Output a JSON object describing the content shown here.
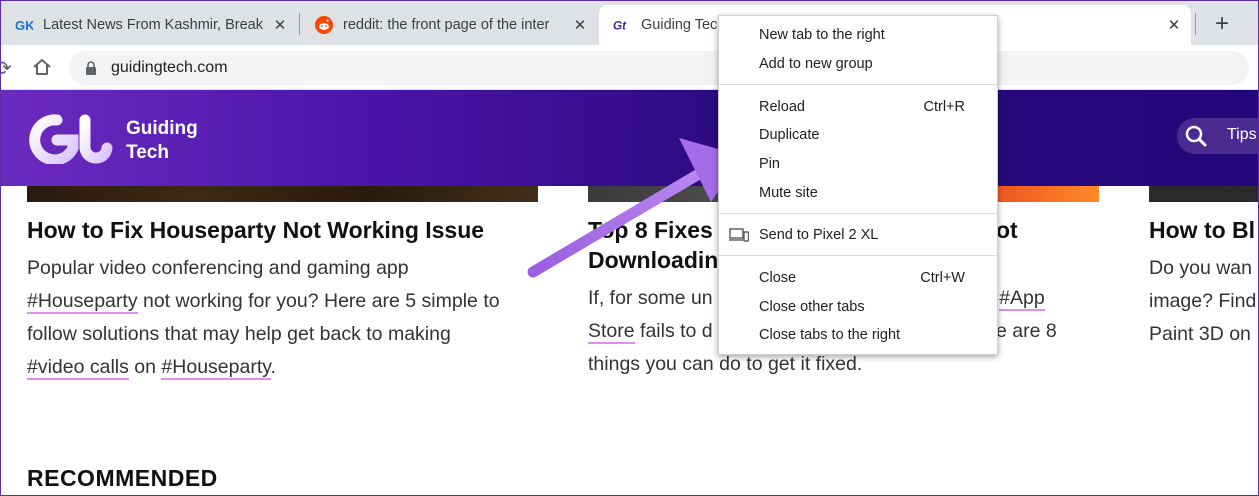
{
  "tabs": [
    {
      "favicon": "gk-icon",
      "title": "Latest News From Kashmir, Break"
    },
    {
      "favicon": "reddit-icon",
      "title": "reddit: the front page of the inter"
    },
    {
      "favicon": "gt-icon",
      "title": "Guiding Tec"
    }
  ],
  "toolbar": {
    "url": "guidingtech.com"
  },
  "site": {
    "brand_line1": "Guiding",
    "brand_line2": "Tech",
    "search_placeholder": "Tips,"
  },
  "articles": [
    {
      "title": "How to Fix Houseparty Not Working Issue",
      "body_1": "Popular video conferencing and gaming app",
      "tag_1": "#Houseparty",
      "body_2": " not working for you? Here are 5 simple to",
      "body_3": "follow solutions that may help get back to making",
      "tag_2": "#video calls",
      "body_4": " on ",
      "tag_3": "#Houseparty",
      "body_5": "."
    },
    {
      "title_line1_a": "Top 8 Fixes",
      "title_line1_b": "ot",
      "title_line2": "Downloadin",
      "body_1": "If, for some un",
      "body_1b": "s ",
      "tag_1": "#App",
      "tag_1b": "Store",
      "body_2": " fails to d",
      "body_2b": "e are 8",
      "body_3": "things you can do to get it fixed."
    },
    {
      "title": "How to Bl",
      "body_1": "Do you wan",
      "body_2": "image? Find",
      "body_3": "Paint 3D on"
    }
  ],
  "recommended": "RECOMMENDED",
  "context_menu": {
    "items": [
      {
        "label": "New tab to the right",
        "shortcut": ""
      },
      {
        "label": "Add to new group",
        "shortcut": ""
      },
      {
        "label": "Reload",
        "shortcut": "Ctrl+R"
      },
      {
        "label": "Duplicate",
        "shortcut": ""
      },
      {
        "label": "Pin",
        "shortcut": ""
      },
      {
        "label": "Mute site",
        "shortcut": ""
      },
      {
        "label": "Send to Pixel 2 XL",
        "shortcut": ""
      },
      {
        "label": "Close",
        "shortcut": "Ctrl+W"
      },
      {
        "label": "Close other tabs",
        "shortcut": ""
      },
      {
        "label": "Close tabs to the right",
        "shortcut": ""
      }
    ]
  },
  "colors": {
    "header_purple": "#2a0a7e",
    "accent_arrow": "#a56ce8",
    "tag_underline": "#e38bf5"
  }
}
